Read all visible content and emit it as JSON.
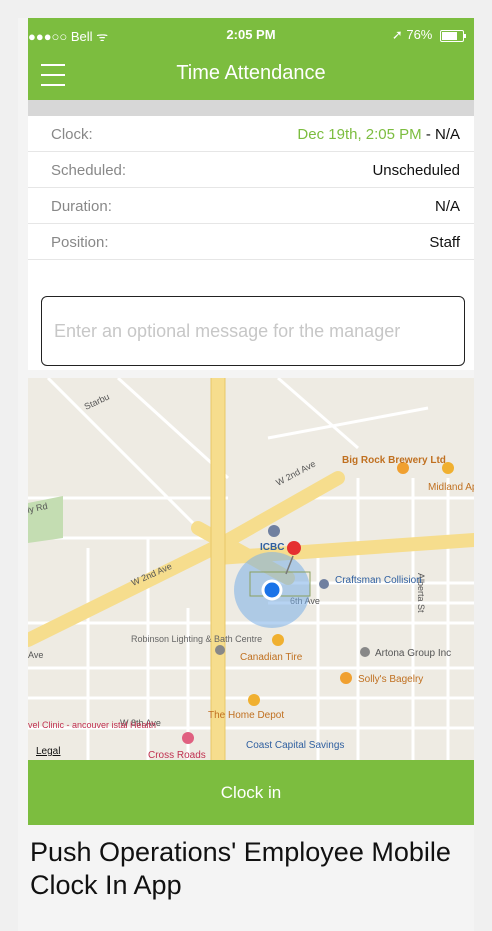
{
  "status_bar": {
    "carrier": "●●●○○ Bell",
    "wifi": "ᯤ",
    "time": "2:05 PM",
    "location_arrow": "➚",
    "battery_percent": "76%",
    "battery_level": 0.76
  },
  "header": {
    "title": "Time Attendance",
    "menu_icon": "hamburger-icon"
  },
  "rows": [
    {
      "label": "Clock:",
      "value_green": "Dec 19th, 2:05 PM",
      "value_rest": " - N/A"
    },
    {
      "label": "Scheduled:",
      "value": "Unscheduled"
    },
    {
      "label": "Duration:",
      "value": "N/A"
    },
    {
      "label": "Position:",
      "value": "Staff"
    }
  ],
  "message": {
    "placeholder": "Enter an optional message for the manager",
    "value": ""
  },
  "map": {
    "streets": [
      "Starbu",
      "W 2nd Ave",
      "W 2nd Ave",
      "ly Rd",
      "Ave",
      "W 8th Ave",
      "Alberta St",
      "6th Ave"
    ],
    "places": [
      "Big Rock Brewery Ltd",
      "Midland Appliance",
      "ICBC",
      "Craftsman Collision",
      "Robinson Lighting & Bath Centre",
      "Canadian Tire",
      "Artona Group Inc",
      "Solly's Bagelry",
      "The Home Depot",
      "vel Clinic - ancouver istal Health",
      "Coast Capital Savings",
      "Cross Roads"
    ],
    "legal": "Legal"
  },
  "clock_in_label": "Clock in",
  "caption": "Push Operations' Employee Mobile Clock In App",
  "colors": {
    "brand_green": "#7cbd3f",
    "map_bg": "#eeebe3",
    "road_yellow": "#f6dd8d"
  }
}
